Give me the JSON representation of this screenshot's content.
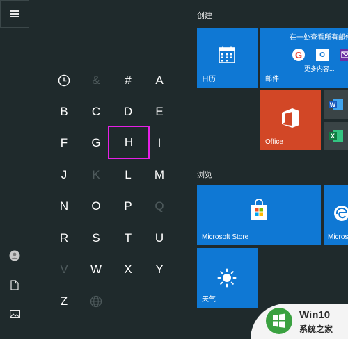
{
  "letters": {
    "row1": [
      "&",
      "#",
      "A"
    ],
    "row2": [
      "B",
      "C",
      "D",
      "E"
    ],
    "row3": [
      "F",
      "G",
      "H",
      "I"
    ],
    "row4": [
      "J",
      "K",
      "L",
      "M"
    ],
    "row5": [
      "N",
      "O",
      "P",
      "Q"
    ],
    "row6": [
      "R",
      "S",
      "T",
      "U"
    ],
    "row7": [
      "V",
      "W",
      "X",
      "Y"
    ],
    "row8": [
      "Z"
    ],
    "selected": "H",
    "disabled": [
      "&",
      "K",
      "Q",
      "V"
    ]
  },
  "groups": {
    "create_title": "创建",
    "browse_title": "浏览"
  },
  "tiles": {
    "calendar_label": "日历",
    "mail_label": "邮件",
    "mail_header": "在一处查看所有邮件",
    "mail_more": "更多内容...",
    "office_label": "Office",
    "store_label": "Microsoft Store",
    "edge_label": "Microsof",
    "weather_label": "天气"
  },
  "watermark": {
    "line1": "Win10",
    "line2": "系统之家"
  },
  "colors": {
    "tile_blue": "#0f78d4",
    "office_orange": "#d24726",
    "selection_magenta": "#e620e6",
    "background": "#1f2a2c"
  }
}
